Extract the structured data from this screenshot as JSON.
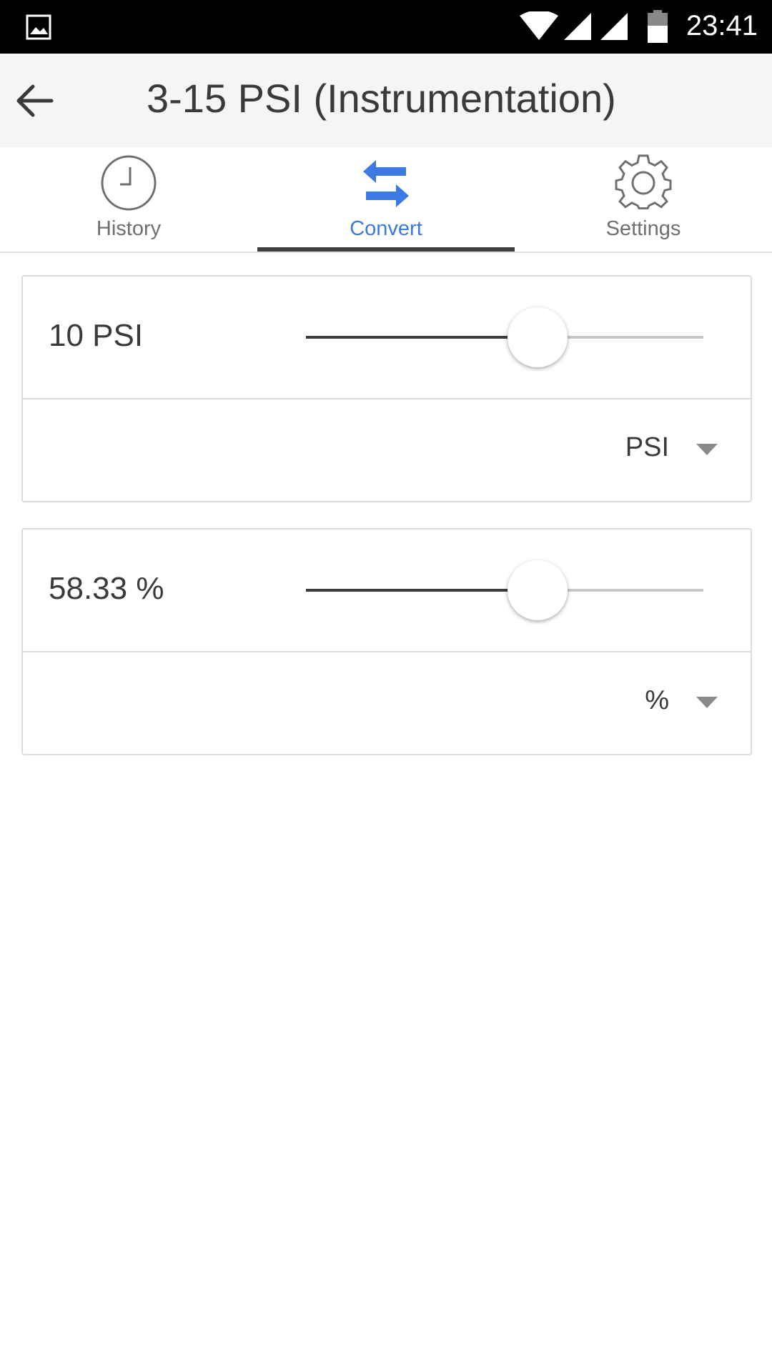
{
  "status_bar": {
    "time": "23:41",
    "icons": [
      "gallery-icon",
      "wifi-icon",
      "signal-icon",
      "signal-icon",
      "battery-icon"
    ]
  },
  "app_bar": {
    "title": "3-15 PSI (Instrumentation)",
    "back_icon": "arrow-back-icon"
  },
  "tabs": [
    {
      "label": "History",
      "icon": "clock-icon",
      "active": false
    },
    {
      "label": "Convert",
      "icon": "swap-arrows-icon",
      "active": true
    },
    {
      "label": "Settings",
      "icon": "gear-icon",
      "active": false
    }
  ],
  "colors": {
    "accent": "#3b7ae0",
    "status_bar": "#000000",
    "app_bar": "#f5f5f5"
  },
  "converter": {
    "input": {
      "value_text": "10 PSI",
      "unit": "PSI",
      "slider_fraction": 0.5833
    },
    "output": {
      "value_text": "58.33 %",
      "unit": "%",
      "slider_fraction": 0.5833
    }
  }
}
